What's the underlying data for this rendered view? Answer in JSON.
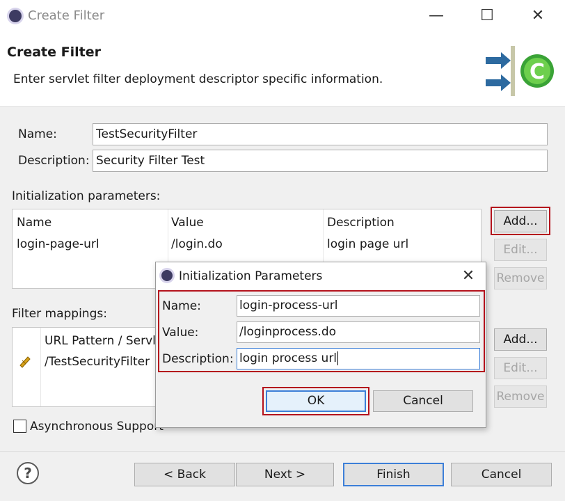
{
  "window": {
    "title": "Create Filter",
    "minimize": "—",
    "maximize": "☐",
    "close": "✕"
  },
  "banner": {
    "title": "Create Filter",
    "description": "Enter servlet filter deployment descriptor specific information."
  },
  "form": {
    "name_label": "Name:",
    "name_value": "TestSecurityFilter",
    "description_label": "Description:",
    "description_value": "Security Filter Test"
  },
  "init_params": {
    "label": "Initialization parameters:",
    "columns": [
      "Name",
      "Value",
      "Description"
    ],
    "rows": [
      [
        "login-page-url",
        "/login.do",
        "login page url"
      ]
    ],
    "add": "Add...",
    "edit": "Edit...",
    "remove": "Remove"
  },
  "filter_mappings": {
    "label": "Filter mappings:",
    "column": "URL Pattern / Servlet",
    "rows": [
      "/TestSecurityFilter"
    ],
    "add": "Add...",
    "edit": "Edit...",
    "remove": "Remove"
  },
  "async": {
    "label": "Asynchronous Support"
  },
  "dialog": {
    "title": "Initialization Parameters",
    "close": "✕",
    "name_label": "Name:",
    "name_value": "login-process-url",
    "value_label": "Value:",
    "value_value": "/loginprocess.do",
    "description_label": "Description:",
    "description_value": "login process url",
    "ok": "OK",
    "cancel": "Cancel"
  },
  "footer": {
    "help": "?",
    "back": "< Back",
    "next": "Next >",
    "finish": "Finish",
    "cancel": "Cancel"
  },
  "colors": {
    "highlight_red": "#b4121c",
    "default_button_blue": "#3c7fd8"
  }
}
